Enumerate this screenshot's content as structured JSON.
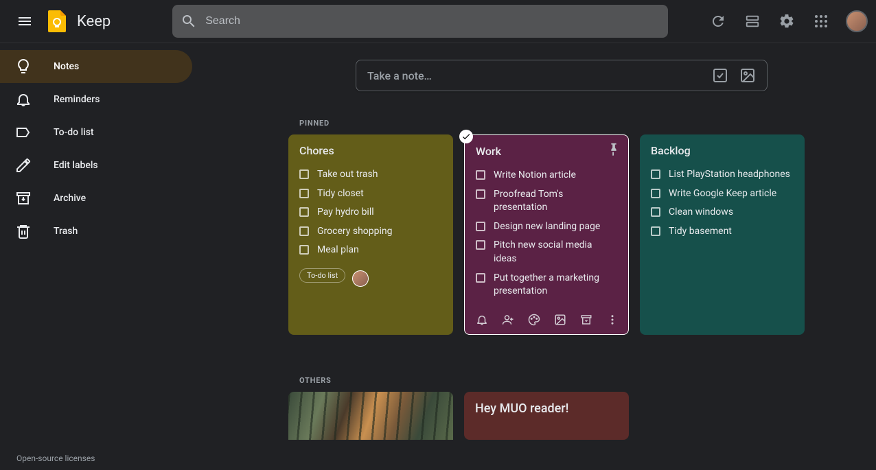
{
  "app": {
    "title": "Keep"
  },
  "search": {
    "placeholder": "Search"
  },
  "sidebar": {
    "items": [
      {
        "label": "Notes"
      },
      {
        "label": "Reminders"
      },
      {
        "label": "To-do list"
      },
      {
        "label": "Edit labels"
      },
      {
        "label": "Archive"
      },
      {
        "label": "Trash"
      }
    ],
    "licenses": "Open-source licenses"
  },
  "takeNote": {
    "placeholder": "Take a note…"
  },
  "sections": {
    "pinned": "PINNED",
    "others": "OTHERS"
  },
  "pinned": [
    {
      "title": "Chores",
      "color": "olive",
      "items": [
        "Take out trash",
        "Tidy closet",
        "Pay hydro bill",
        "Grocery shopping",
        "Meal plan"
      ],
      "chip": "To-do list",
      "sharedAvatar": true
    },
    {
      "title": "Work",
      "color": "purple",
      "selected": true,
      "items": [
        "Write Notion article",
        "Proofread Tom's presentation",
        "Design new landing page",
        "Pitch new social media ideas",
        "Put together a marketing presentation"
      ],
      "toolbar": true
    },
    {
      "title": "Backlog",
      "color": "teal",
      "items": [
        "List PlayStation headphones",
        "Write Google Keep article",
        "Clean windows",
        "Tidy basement"
      ]
    }
  ],
  "others": [
    {
      "type": "image"
    },
    {
      "title": "Hey MUO reader!",
      "color": "maroon"
    }
  ]
}
